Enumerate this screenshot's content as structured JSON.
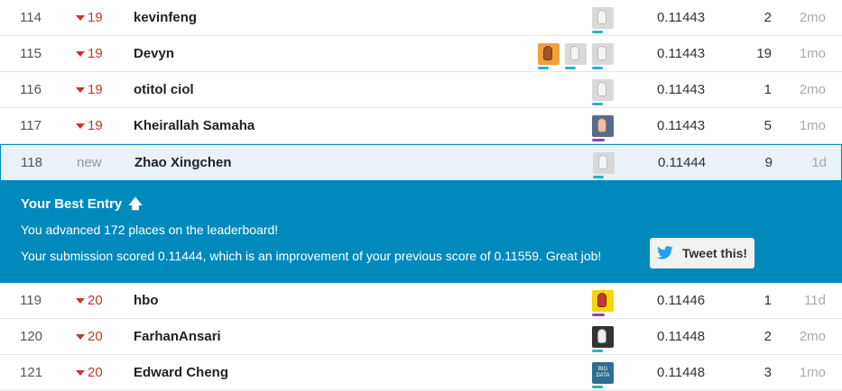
{
  "rows_top": [
    {
      "rank": "114",
      "change": "19",
      "change_type": "down",
      "name": "kevinfeng",
      "avatars": [
        "hand"
      ],
      "score": "0.11443",
      "entries": "2",
      "last": "2mo"
    },
    {
      "rank": "115",
      "change": "19",
      "change_type": "down",
      "name": "Devyn",
      "avatars": [
        "orange",
        "hand",
        "hand"
      ],
      "score": "0.11443",
      "entries": "19",
      "last": "1mo"
    },
    {
      "rank": "116",
      "change": "19",
      "change_type": "down",
      "name": "otitol ciol",
      "avatars": [
        "hand"
      ],
      "score": "0.11443",
      "entries": "1",
      "last": "2mo"
    },
    {
      "rank": "117",
      "change": "19",
      "change_type": "down",
      "name": "Kheirallah Samaha",
      "avatars": [
        "photo2"
      ],
      "score": "0.11443",
      "entries": "5",
      "last": "1mo"
    },
    {
      "rank": "118",
      "change": "new",
      "change_type": "new",
      "name": "Zhao Xingchen",
      "avatars": [
        "hand"
      ],
      "score": "0.11444",
      "entries": "9",
      "last": "1d"
    }
  ],
  "best_entry": {
    "title": "Your Best Entry",
    "line1": "You advanced 172 places on the leaderboard!",
    "line2": "Your submission scored 0.11444, which is an improvement of your previous score of 0.11559. Great job!",
    "tweet_label": "Tweet this!"
  },
  "rows_bottom": [
    {
      "rank": "119",
      "change": "20",
      "change_type": "down",
      "name": "hbo",
      "avatars": [
        "yellow"
      ],
      "score": "0.11446",
      "entries": "1",
      "last": "11d"
    },
    {
      "rank": "120",
      "change": "20",
      "change_type": "down",
      "name": "FarhanAnsari",
      "avatars": [
        "dark"
      ],
      "score": "0.11448",
      "entries": "2",
      "last": "2mo"
    },
    {
      "rank": "121",
      "change": "20",
      "change_type": "down",
      "name": "Edward Cheng",
      "avatars": [
        "bigdata"
      ],
      "score": "0.11448",
      "entries": "3",
      "last": "1mo"
    }
  ],
  "bigdata_text": "BIG DATA",
  "colors": {
    "accent": "#008abc",
    "down": "#c0392b",
    "twitter": "#1da1f2"
  }
}
